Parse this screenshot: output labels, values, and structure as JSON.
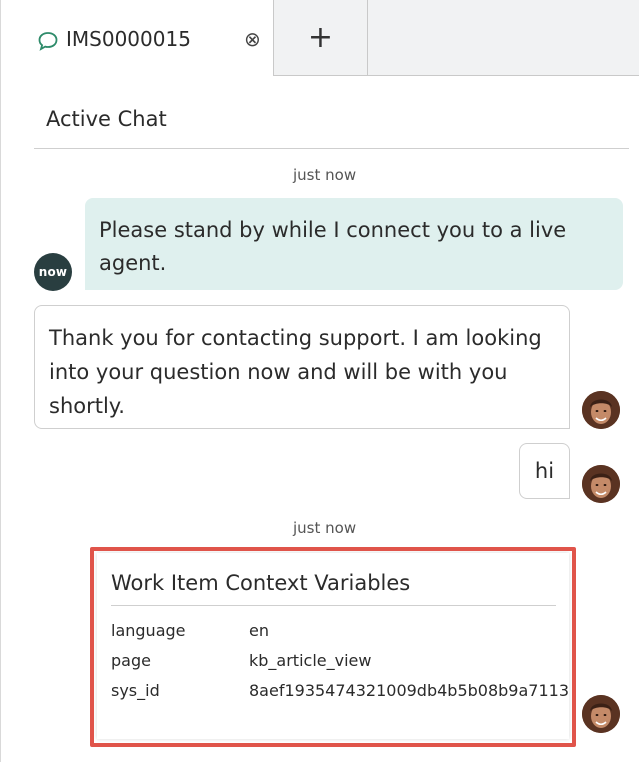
{
  "tab": {
    "title": "IMS0000015",
    "close_symbol": "⊗",
    "add_symbol": "+"
  },
  "header": {
    "title": "Active Chat"
  },
  "messages": {
    "timestamp_1": "just now",
    "bot_text": "Please stand by while I connect you to a live agent.",
    "bot_avatar_text": "now",
    "agent_text": "Thank you for contacting support. I am looking into your question now and will be with you shortly.",
    "user_text": "hi",
    "timestamp_2": "just now"
  },
  "context_card": {
    "title": "Work Item Context Variables",
    "rows": [
      {
        "key": "language",
        "value": "en"
      },
      {
        "key": "page",
        "value": "kb_article_view"
      },
      {
        "key": "sys_id",
        "value": "8aef1935474321009db4b5b08b9a7113"
      }
    ]
  },
  "colors": {
    "bot_bubble": "#dff0ee",
    "now_avatar": "#293e40",
    "highlight": "#e0544a",
    "tab_inactive": "#f1f2f3"
  }
}
